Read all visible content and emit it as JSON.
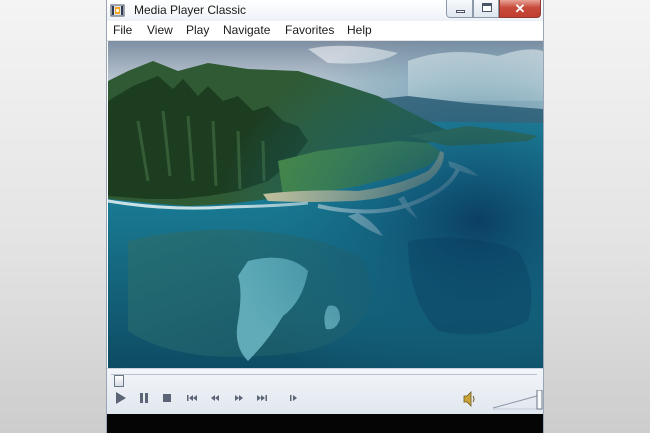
{
  "window": {
    "title": "Media Player Classic"
  },
  "caption_buttons": {
    "minimize_icon": "minimize-icon",
    "maximize_icon": "maximize-icon",
    "close_icon": "close-icon",
    "close_glyph": "✕"
  },
  "menu": {
    "items": [
      {
        "label": "File"
      },
      {
        "label": "View"
      },
      {
        "label": "Play"
      },
      {
        "label": "Navigate"
      },
      {
        "label": "Favorites"
      },
      {
        "label": "Help"
      }
    ]
  },
  "video": {
    "description_icon": "video-frame"
  },
  "playback": {
    "position_fraction": 0.0,
    "buttons": [
      "play-icon",
      "pause-icon",
      "stop-icon",
      "skip-back-icon",
      "rewind-icon",
      "fast-forward-icon",
      "skip-forward-icon",
      "frame-step-icon"
    ]
  },
  "volume": {
    "icon": "speaker-icon",
    "level_fraction": 1.0
  },
  "colors": {
    "close_button": "#c74a3c",
    "controls_background": "#e1e7ef"
  }
}
